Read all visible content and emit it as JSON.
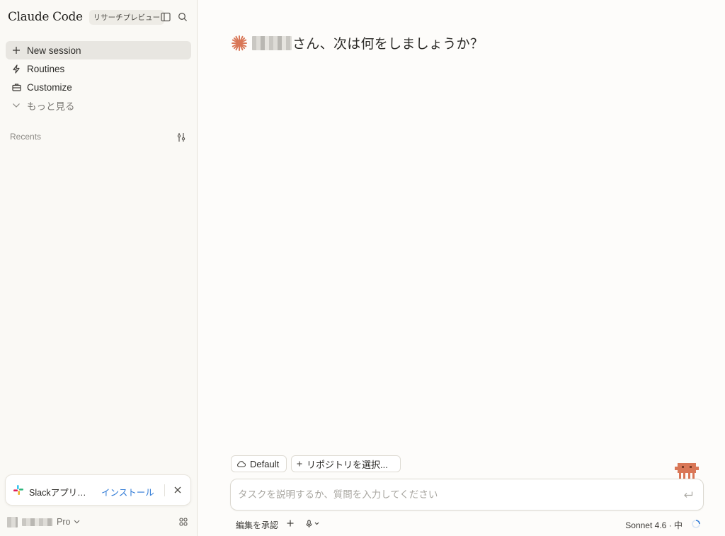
{
  "app": {
    "title": "Claude Code",
    "badge": "リサーチプレビュー"
  },
  "sidebar": {
    "nav": [
      {
        "label": "New session",
        "icon": "plus-icon",
        "active": true
      },
      {
        "label": "Routines",
        "icon": "lightning-icon"
      },
      {
        "label": "Customize",
        "icon": "briefcase-icon"
      },
      {
        "label": "もっと見る",
        "icon": "chevron-down-icon"
      }
    ],
    "recents_label": "Recents"
  },
  "slack_banner": {
    "title": "Slackアプリ…",
    "install_label": "インストール"
  },
  "account": {
    "plan": "Pro"
  },
  "main": {
    "greeting": "さん、次は何をしましょうか？",
    "env_chip": "Default",
    "repo_chip": "リポジトリを選択...",
    "input_placeholder": "タスクを説明するか、質問を入力してください",
    "accept_edits_label": "編集を承認",
    "model_label": "Sonnet 4.6 · 中"
  },
  "colors": {
    "accent": "#d97757",
    "link": "#2f7ad6",
    "sidebar_bg": "#faf9f5",
    "active_item_bg": "#e8e6e1"
  }
}
